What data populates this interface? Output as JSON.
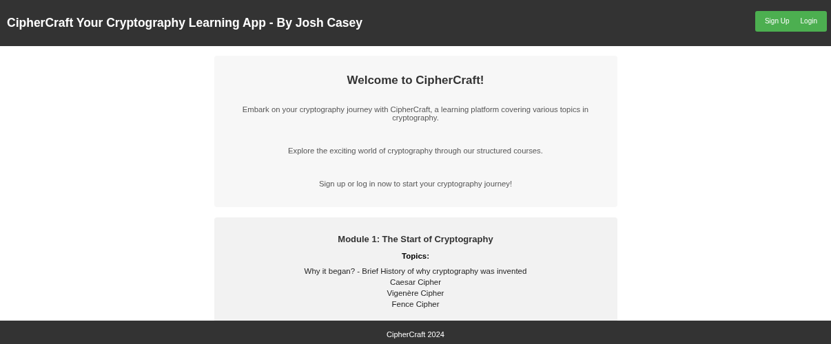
{
  "header": {
    "title": "CipherCraft Your Cryptography Learning App - By Josh Casey",
    "buttons": [
      "Sign Up",
      "Login"
    ]
  },
  "welcome": {
    "heading": "Welcome to CipherCraft!",
    "paragraphs": [
      "Embark on your cryptography journey with CipherCraft, a learning platform covering various topics in cryptography.",
      "Explore the exciting world of cryptography through our structured courses.",
      "Sign up or log in now to start your cryptography journey!"
    ]
  },
  "module": {
    "heading": "Module 1: The Start of Cryptography",
    "topics_label": "Topics:",
    "topics": [
      "Why it began? - Brief History of why cryptography was invented",
      "Caesar Cipher",
      "Vigenère Cipher",
      "Fence Cipher"
    ]
  },
  "footer": {
    "text": "CipherCraft 2024"
  }
}
